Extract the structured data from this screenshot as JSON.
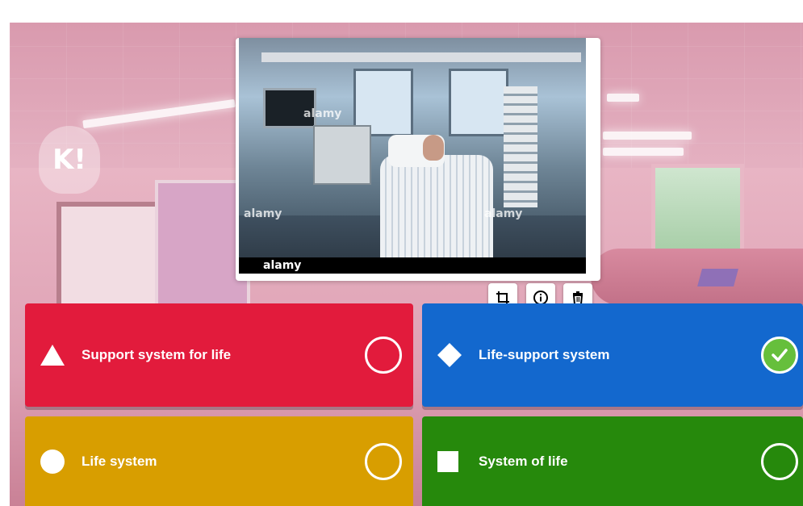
{
  "question_image": {
    "watermark": "alamy",
    "tools": {
      "crop_icon": "crop-icon",
      "info_icon": "info-icon",
      "delete_icon": "trash-icon"
    }
  },
  "answers": [
    {
      "label": "Support system for life",
      "shape": "triangle",
      "color": "#e21b3c",
      "selected": false
    },
    {
      "label": "Life-support system",
      "shape": "diamond",
      "color": "#1368ce",
      "selected": true
    },
    {
      "label": "Life system",
      "shape": "circle",
      "color": "#d89e00",
      "selected": false
    },
    {
      "label": "System of life",
      "shape": "square",
      "color": "#26890c",
      "selected": false
    }
  ],
  "colors": {
    "red": "#e21b3c",
    "blue": "#1368ce",
    "yellow": "#d89e00",
    "green": "#26890c",
    "check": "#66bf3c"
  }
}
